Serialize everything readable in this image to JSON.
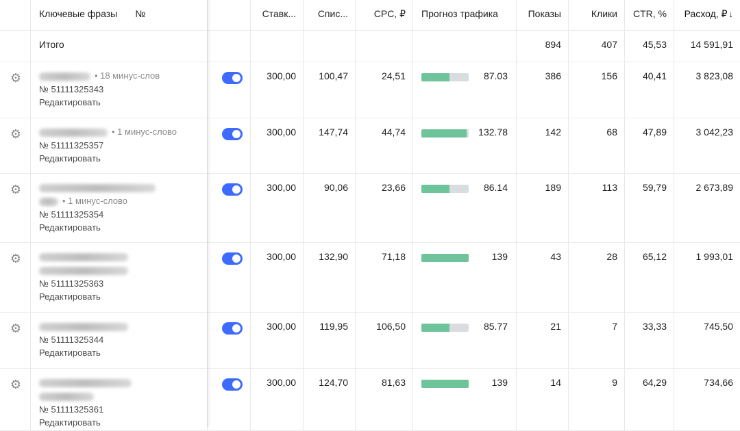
{
  "header": {
    "keywords": "Ключевые фразы",
    "number": "№",
    "bid": "Ставк...",
    "spis": "Спис...",
    "cpc": "CPC, ₽",
    "forecast": "Прогноз трафика",
    "shows": "Показы",
    "clicks": "Клики",
    "ctr": "CTR, %",
    "cost": "Расход, ₽",
    "sort_arrow": "↓"
  },
  "total": {
    "label": "Итого",
    "shows": "894",
    "clicks": "407",
    "ctr": "45,53",
    "cost": "14 591,91"
  },
  "edit_label": "Редактировать",
  "rows": [
    {
      "minus": "• 18 минус-слов",
      "id": "№ 51111325343",
      "bid": "300,00",
      "spis": "100,47",
      "cpc": "24,51",
      "forecast": "87.03",
      "forecast_fill": 0.6,
      "shows": "386",
      "clicks": "156",
      "ctr": "40,41",
      "cost": "3 823,08"
    },
    {
      "minus": "• 1 минус-слово",
      "id": "№ 51111325357",
      "bid": "300,00",
      "spis": "147,74",
      "cpc": "44,74",
      "forecast": "132.78",
      "forecast_fill": 0.95,
      "shows": "142",
      "clicks": "68",
      "ctr": "47,89",
      "cost": "3 042,23"
    },
    {
      "minus": "• 1 минус-слово",
      "id": "№ 51111325354",
      "bid": "300,00",
      "spis": "90,06",
      "cpc": "23,66",
      "forecast": "86.14",
      "forecast_fill": 0.6,
      "shows": "189",
      "clicks": "113",
      "ctr": "59,79",
      "cost": "2 673,89"
    },
    {
      "minus": "",
      "id": "№ 51111325363",
      "bid": "300,00",
      "spis": "132,90",
      "cpc": "71,18",
      "forecast": "139",
      "forecast_fill": 1.0,
      "shows": "43",
      "clicks": "28",
      "ctr": "65,12",
      "cost": "1 993,01"
    },
    {
      "minus": "",
      "id": "№ 51111325344",
      "bid": "300,00",
      "spis": "119,95",
      "cpc": "106,50",
      "forecast": "85.77",
      "forecast_fill": 0.6,
      "shows": "21",
      "clicks": "7",
      "ctr": "33,33",
      "cost": "745,50"
    },
    {
      "minus": "",
      "id": "№ 51111325361",
      "bid": "300,00",
      "spis": "124,70",
      "cpc": "81,63",
      "forecast": "139",
      "forecast_fill": 1.0,
      "shows": "14",
      "clicks": "9",
      "ctr": "64,29",
      "cost": "734,66"
    }
  ],
  "colors": {
    "toggle": "#3d6bff",
    "bar_fill": "#6fc39a",
    "bar_track": "#d9dce1"
  }
}
